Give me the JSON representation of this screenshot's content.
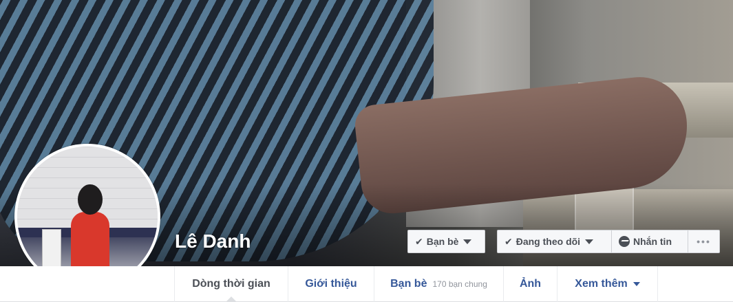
{
  "profile": {
    "name": "Lê Danh"
  },
  "actions": {
    "friends_label": "Bạn bè",
    "following_label": "Đang theo dõi",
    "message_label": "Nhắn tin",
    "more_label": "•••"
  },
  "nav": {
    "timeline": "Dòng thời gian",
    "about": "Giới thiệu",
    "friends": "Bạn bè",
    "mutual_friends": "170 bạn chung",
    "photos": "Ảnh",
    "more": "Xem thêm"
  },
  "icons": {
    "check": "check-icon",
    "caret": "caret-down-icon",
    "messenger": "messenger-icon",
    "ellipsis": "ellipsis-icon"
  },
  "colors": {
    "link_blue": "#365899",
    "text_dark": "#4b4f56",
    "button_bg": "#f6f7f9",
    "border": "#ced0d4"
  }
}
